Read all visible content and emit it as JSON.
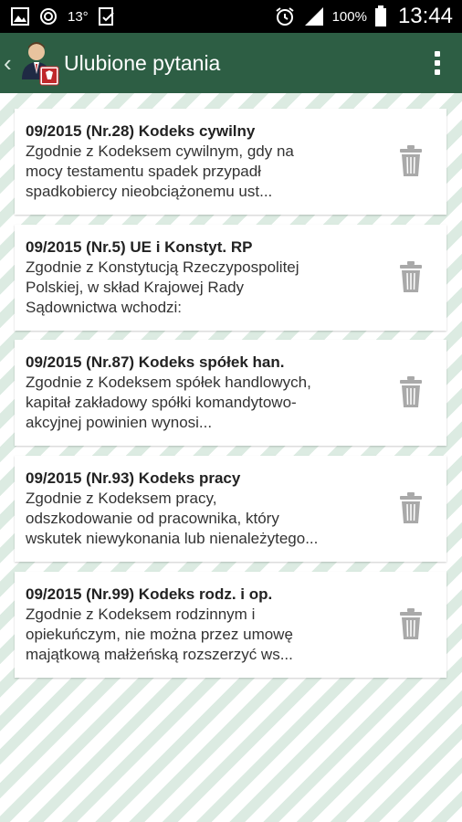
{
  "status_bar": {
    "notification_icons": [
      "image-icon",
      "sync-icon",
      "temperature-icon",
      "clipboard-check-icon"
    ],
    "temperature": "13°",
    "battery": "100%",
    "time": "13:44"
  },
  "app_bar": {
    "title": "Ulubione pytania",
    "color": "#2d5e44"
  },
  "favorites": [
    {
      "title": "09/2015 (Nr.28) Kodeks cywilny",
      "lines": [
        "Zgodnie z Kodeksem cywilnym, gdy na",
        "mocy testamentu spadek przypadł",
        "spadkobiercy nieobciążonemu ust..."
      ]
    },
    {
      "title": "09/2015 (Nr.5) UE i Konstyt. RP",
      "lines": [
        "Zgodnie z Konstytucją Rzeczypospolitej",
        "Polskiej, w skład Krajowej Rady",
        "Sądownictwa wchodzi:"
      ]
    },
    {
      "title": "09/2015 (Nr.87) Kodeks spółek han.",
      "lines": [
        "Zgodnie z Kodeksem spółek handlowych,",
        "kapitał zakładowy spółki komandytowo-",
        "akcyjnej powinien wynosi..."
      ]
    },
    {
      "title": "09/2015 (Nr.93) Kodeks pracy",
      "lines": [
        "Zgodnie z Kodeksem pracy,",
        "odszkodowanie od pracownika, który",
        "wskutek niewykonania lub nienależytego..."
      ]
    },
    {
      "title": "09/2015 (Nr.99) Kodeks rodz. i op.",
      "lines": [
        "Zgodnie z Kodeksem rodzinnym i",
        "opiekuńczym, nie można przez umowę",
        "majątkową małżeńską rozszerzyć ws..."
      ]
    }
  ]
}
